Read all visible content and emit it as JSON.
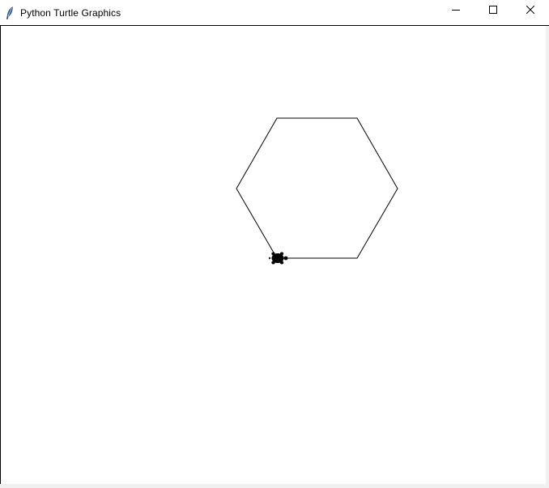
{
  "window": {
    "title": "Python Turtle Graphics",
    "app_icon": "feather-icon"
  },
  "controls": {
    "minimize_icon": "minimize-icon",
    "maximize_icon": "maximize-icon",
    "close_icon": "close-icon"
  },
  "canvas": {
    "background": "#ffffff",
    "pen_color": "#000000",
    "shape": "hexagon",
    "turtle_icon": "turtle-icon",
    "turtle_heading": "east"
  }
}
